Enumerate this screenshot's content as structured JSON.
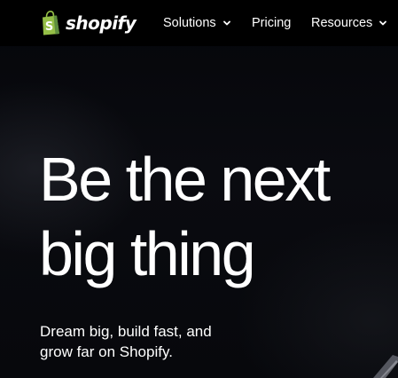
{
  "brand": {
    "name": "shopify",
    "logo_icon": "shopping-bag-icon",
    "logo_color": "#95bf47"
  },
  "nav": {
    "items": [
      {
        "label": "Solutions",
        "has_dropdown": true
      },
      {
        "label": "Pricing",
        "has_dropdown": false
      },
      {
        "label": "Resources",
        "has_dropdown": true
      }
    ]
  },
  "hero": {
    "title_line1": "Be the next",
    "title_line2": "big thing",
    "subtitle_line1": "Dream big, build fast, and",
    "subtitle_line2": "grow far on Shopify."
  },
  "colors": {
    "background": "#000000",
    "text": "#ffffff",
    "accent": "#95bf47"
  }
}
